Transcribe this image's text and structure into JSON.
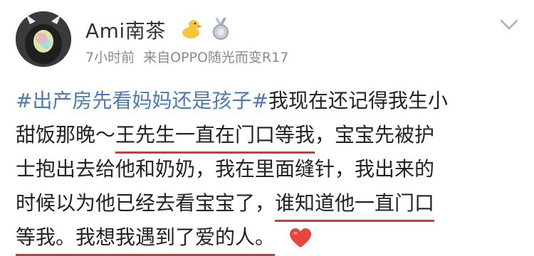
{
  "profile": {
    "username": "Ami南茶",
    "time_ago": "7小时前",
    "source": "来自OPPO随光而变R17"
  },
  "post": {
    "hashtag": "#出产房先看妈妈还是孩子#",
    "line1_after_tag": "我现在还记得我生小",
    "line2_a": "甜饭那晚～",
    "line2_underlined": "王先生一直在门口等我",
    "line2_b": "，宝宝先被护",
    "line3": "士抱出去给他和奶奶，我在里面缝针，我出来的",
    "line4_a": "时候以为他已经去看宝宝了，",
    "line4_underlined": "谁知道他一直门口",
    "line5_underlined": "等我。我想我遇到了爱的人。",
    "emoji": "heart-icon"
  },
  "colors": {
    "hashtag": "#4b7ab3",
    "underline": "#d9343a",
    "meta_text": "#8a8a8a"
  }
}
